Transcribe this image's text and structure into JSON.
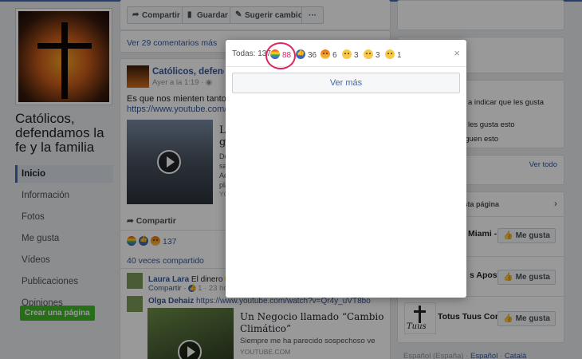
{
  "page": {
    "name": "Católicos, defendamos la fe y la familia",
    "nav": [
      "Inicio",
      "Información",
      "Fotos",
      "Me gusta",
      "Vídeos",
      "Publicaciones",
      "Opiniones"
    ],
    "create_page": "Crear una página"
  },
  "toolbar": {
    "share": "Compartir",
    "save": "Guardar",
    "suggest": "Sugerir cambios",
    "more": "···"
  },
  "feed": {
    "comments_more": "Ver 29 comentarios más",
    "post_title": "Católicos, defendamos la fe",
    "post_time": "Ayer a la 1:19 · ",
    "post_text": "Es que nos mienten tanto! Pe",
    "post_url": "https://www.youtube.com/wa",
    "video1_side": "La gl",
    "video1_desc": "Do sa Ac pla",
    "video1_src": "YC",
    "share_label": "Compartir",
    "reactions_total": "137",
    "shared_count": "40 veces compartido",
    "comment1_author": "Laura Lara",
    "comment1_text": "El dinero",
    "comment1_tail": "la",
    "comment1_actions": "Compartir · ",
    "comment1_likes": "1",
    "comment1_time": " · 23 horas",
    "comment2_author": "Olga Dehaiz",
    "comment2_url": "https://www.youtube.com/watch?v=Qr4y_uVT8bo",
    "video2_title": "Un Negocio llamado “Cambio Climático”",
    "video2_desc": "Siempre me ha parecido sospechoso ver a...",
    "video2_src": "YOUTUBE.COM"
  },
  "sidebar": {
    "invite_link": "gos",
    "invite_text": " a indicar que les gusta",
    "likes_text": "nas les gusta esto",
    "follows_text": "s siguen esto",
    "see_all": "Ver todo",
    "pages_header": "a esta página",
    "like_label": "Me gusta",
    "suggestions": [
      "Miami - P...",
      "s Apostóli...",
      "Totus Tuus Contr..."
    ],
    "totus_logo": "Tuus"
  },
  "footer": {
    "langs": [
      "Español (España)",
      "Español",
      "Català"
    ]
  },
  "modal": {
    "all_label": "Todas: 137",
    "reactions": [
      {
        "icon": "rainbow-reaction-icon",
        "count": "88"
      },
      {
        "icon": "like-reaction-icon",
        "count": "36"
      },
      {
        "icon": "angry-reaction-icon",
        "count": "6"
      },
      {
        "icon": "wow-reaction-icon",
        "count": "3"
      },
      {
        "icon": "sad-reaction-icon",
        "count": "3"
      },
      {
        "icon": "haha-reaction-icon",
        "count": "1"
      }
    ],
    "see_more": "Ver más",
    "close": "×"
  },
  "colors": {
    "accent": "#4267b2",
    "link": "#365899",
    "highlight_circle": "#e0245e",
    "create_green": "#42b72a"
  }
}
